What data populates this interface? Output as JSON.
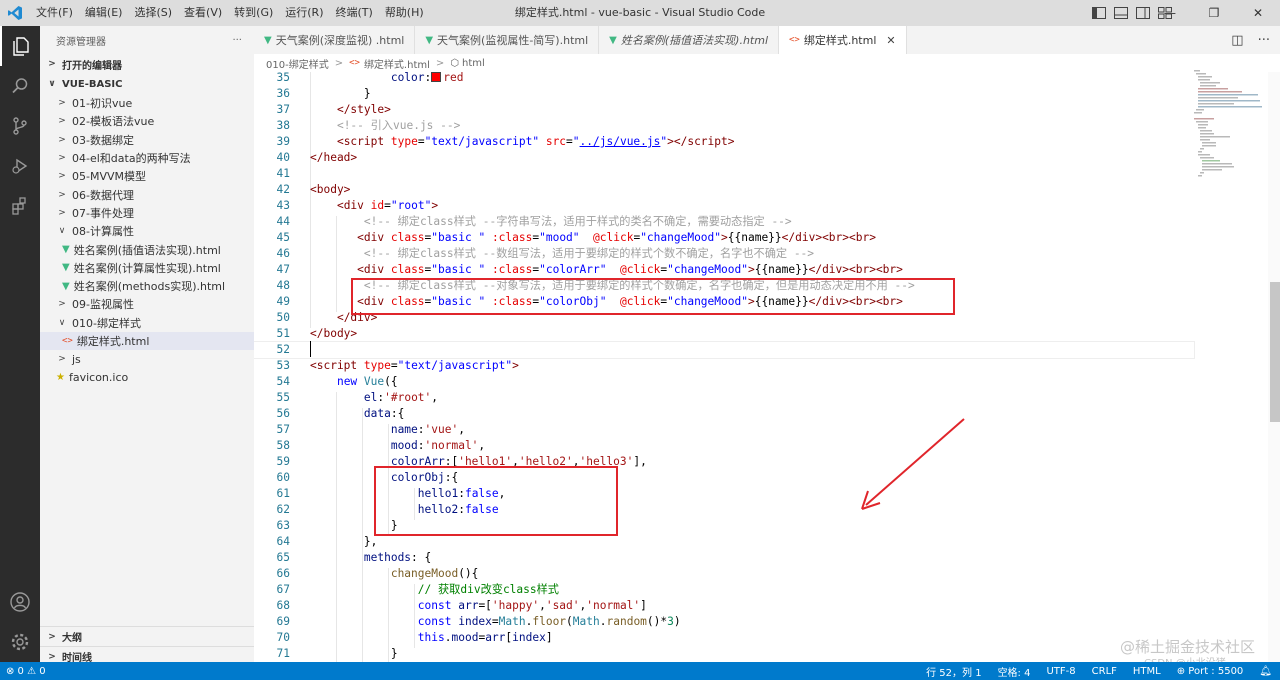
{
  "window": {
    "title": "绑定样式.html - vue-basic - Visual Studio Code",
    "menu": [
      "文件(F)",
      "编辑(E)",
      "选择(S)",
      "查看(V)",
      "转到(G)",
      "运行(R)",
      "终端(T)",
      "帮助(H)"
    ]
  },
  "sidebar": {
    "header": "资源管理器",
    "more": "···",
    "open_editors": "打开的编辑器",
    "project": "VUE-BASIC",
    "items": [
      {
        "label": "01-初识vue",
        "type": "folder",
        "indent": 1
      },
      {
        "label": "02-模板语法vue",
        "type": "folder",
        "indent": 1
      },
      {
        "label": "03-数据绑定",
        "type": "folder",
        "indent": 1
      },
      {
        "label": "04-el和data的两种写法",
        "type": "folder",
        "indent": 1
      },
      {
        "label": "05-MVVM模型",
        "type": "folder",
        "indent": 1
      },
      {
        "label": "06-数据代理",
        "type": "folder",
        "indent": 1
      },
      {
        "label": "07-事件处理",
        "type": "folder",
        "indent": 1
      },
      {
        "label": "08-计算属性",
        "type": "folder-open",
        "indent": 1
      },
      {
        "label": "姓名案例(插值语法实现).html",
        "type": "vue-file",
        "indent": 2
      },
      {
        "label": "姓名案例(计算属性实现).html",
        "type": "vue-file",
        "indent": 2
      },
      {
        "label": "姓名案例(methods实现).html",
        "type": "vue-file",
        "indent": 2
      },
      {
        "label": "09-监视属性",
        "type": "folder",
        "indent": 1
      },
      {
        "label": "010-绑定样式",
        "type": "folder-open",
        "indent": 1
      },
      {
        "label": "绑定样式.html",
        "type": "html-file",
        "indent": 2,
        "selected": true
      },
      {
        "label": "js",
        "type": "folder",
        "indent": 1
      },
      {
        "label": "favicon.ico",
        "type": "ico-file",
        "indent": 1
      }
    ],
    "outline": "大纲",
    "timeline": "时间线"
  },
  "tabs": [
    {
      "label": "天气案例(深度监视) .html",
      "icon": "vue",
      "active": false,
      "italic": false
    },
    {
      "label": "天气案例(监视属性-简写).html",
      "icon": "vue",
      "active": false,
      "italic": false
    },
    {
      "label": "姓名案例(插值语法实现).html",
      "icon": "vue",
      "active": false,
      "italic": true
    },
    {
      "label": "绑定样式.html",
      "icon": "html",
      "active": true,
      "italic": false
    }
  ],
  "breadcrumb": [
    "010-绑定样式",
    "绑定样式.html",
    "html"
  ],
  "editor": {
    "current_line": 52,
    "lines": [
      {
        "n": 35,
        "html": "            <span class=\"t-prop\">color</span>:<span class=\"swatch\"></span><span class=\"t-str2\">red</span>"
      },
      {
        "n": 36,
        "html": "        }"
      },
      {
        "n": 37,
        "html": "    <span class=\"t-tag\">&lt;/style&gt;</span>"
      },
      {
        "n": 38,
        "html": "    <span class=\"t-com2\">&lt;!-- 引入vue.js --&gt;</span>"
      },
      {
        "n": 39,
        "html": "    <span class=\"t-tag\">&lt;script</span> <span class=\"t-attr\">type</span>=<span class=\"t-str\">\"text/javascript\"</span> <span class=\"t-attr\">src</span>=<span class=\"t-str\">\"<u>../js/vue.js</u>\"</span><span class=\"t-tag\">&gt;&lt;/script&gt;</span>"
      },
      {
        "n": 40,
        "html": "<span class=\"t-tag\">&lt;/head&gt;</span>"
      },
      {
        "n": 41,
        "html": ""
      },
      {
        "n": 42,
        "html": "<span class=\"t-tag\">&lt;body&gt;</span>"
      },
      {
        "n": 43,
        "html": "    <span class=\"t-tag\">&lt;div</span> <span class=\"t-attr\">id</span>=<span class=\"t-str\">\"root\"</span><span class=\"t-tag\">&gt;</span>"
      },
      {
        "n": 44,
        "html": "        <span class=\"t-com2\">&lt;!-- 绑定class样式 --字符串写法，适用于样式的类名不确定，需要动态指定 --&gt;</span>"
      },
      {
        "n": 45,
        "html": "       <span class=\"t-tag\">&lt;div</span> <span class=\"t-attr\">class</span>=<span class=\"t-str\">\"basic \"</span> <span class=\"t-attr\">:class</span>=<span class=\"t-str\">\"mood\"</span>  <span class=\"t-attr\">@click</span>=<span class=\"t-str\">\"changeMood\"</span><span class=\"t-tag\">&gt;</span>{{name}}<span class=\"t-tag\">&lt;/div&gt;&lt;br&gt;&lt;br&gt;</span>"
      },
      {
        "n": 46,
        "html": "        <span class=\"t-com2\">&lt;!-- 绑定class样式 --数组写法，适用于要绑定的样式个数不确定，名字也不确定 --&gt;</span>"
      },
      {
        "n": 47,
        "html": "       <span class=\"t-tag\">&lt;div</span> <span class=\"t-attr\">class</span>=<span class=\"t-str\">\"basic \"</span> <span class=\"t-attr\">:class</span>=<span class=\"t-str\">\"colorArr\"</span>  <span class=\"t-attr\">@click</span>=<span class=\"t-str\">\"changeMood\"</span><span class=\"t-tag\">&gt;</span>{{name}}<span class=\"t-tag\">&lt;/div&gt;&lt;br&gt;&lt;br&gt;</span>"
      },
      {
        "n": 48,
        "html": "        <span class=\"t-com2\">&lt;!-- 绑定class样式 --对象写法，适用于要绑定的样式个数确定，名字也确定，但是用动态决定用不用 --&gt;</span>"
      },
      {
        "n": 49,
        "html": "       <span class=\"t-tag\">&lt;div</span> <span class=\"t-attr\">class</span>=<span class=\"t-str\">\"basic \"</span> <span class=\"t-attr\">:class</span>=<span class=\"t-str\">\"colorObj\"</span>  <span class=\"t-attr\">@click</span>=<span class=\"t-str\">\"changeMood\"</span><span class=\"t-tag\">&gt;</span>{{name}}<span class=\"t-tag\">&lt;/div&gt;&lt;br&gt;&lt;br&gt;</span>"
      },
      {
        "n": 50,
        "html": "    <span class=\"t-tag\">&lt;/div&gt;</span>"
      },
      {
        "n": 51,
        "html": "<span class=\"t-tag\">&lt;/body&gt;</span>"
      },
      {
        "n": 52,
        "html": ""
      },
      {
        "n": 53,
        "html": "<span class=\"t-tag\">&lt;script</span> <span class=\"t-attr\">type</span>=<span class=\"t-str\">\"text/javascript\"</span><span class=\"t-tag\">&gt;</span>"
      },
      {
        "n": 54,
        "html": "    <span class=\"t-kw\">new</span> <span class=\"t-cls\">Vue</span>({"
      },
      {
        "n": 55,
        "html": "        <span class=\"t-prop\">el</span>:<span class=\"t-str2\">'#root'</span>,"
      },
      {
        "n": 56,
        "html": "        <span class=\"t-prop\">data</span>:{"
      },
      {
        "n": 57,
        "html": "            <span class=\"t-prop\">name</span>:<span class=\"t-str2\">'vue'</span>,"
      },
      {
        "n": 58,
        "html": "            <span class=\"t-prop\">mood</span>:<span class=\"t-str2\">'normal'</span>,"
      },
      {
        "n": 59,
        "html": "            <span class=\"t-prop\">colorArr</span>:[<span class=\"t-str2\">'hello1'</span>,<span class=\"t-str2\">'hello2'</span>,<span class=\"t-str2\">'hello3'</span>],"
      },
      {
        "n": 60,
        "html": "            <span class=\"t-prop\">colorObj</span>:{"
      },
      {
        "n": 61,
        "html": "                <span class=\"t-prop\">hello1</span>:<span class=\"t-kw\">false</span>,"
      },
      {
        "n": 62,
        "html": "                <span class=\"t-prop\">hello2</span>:<span class=\"t-kw\">false</span>"
      },
      {
        "n": 63,
        "html": "            }"
      },
      {
        "n": 64,
        "html": "        },"
      },
      {
        "n": 65,
        "html": "        <span class=\"t-prop\">methods</span>: {"
      },
      {
        "n": 66,
        "html": "            <span class=\"t-fn\">changeMood</span>(){"
      },
      {
        "n": 67,
        "html": "                <span class=\"t-com\">// 获取div改变class样式</span>"
      },
      {
        "n": 68,
        "html": "                <span class=\"t-kw\">const</span> <span class=\"t-prop\">arr</span>=[<span class=\"t-str2\">'happy'</span>,<span class=\"t-str2\">'sad'</span>,<span class=\"t-str2\">'normal'</span>]"
      },
      {
        "n": 69,
        "html": "                <span class=\"t-kw\">const</span> <span class=\"t-prop\">index</span>=<span class=\"t-cls\">Math</span>.<span class=\"t-fn\">floor</span>(<span class=\"t-cls\">Math</span>.<span class=\"t-fn\">random</span>()*<span class=\"t-num\">3</span>)"
      },
      {
        "n": 70,
        "html": "                <span class=\"t-kw\">this</span>.<span class=\"t-prop\">mood</span>=<span class=\"t-prop\">arr</span>[<span class=\"t-prop\">index</span>]"
      },
      {
        "n": 71,
        "html": "            }"
      },
      {
        "n": 72,
        "html": "        }"
      }
    ]
  },
  "watermark": {
    "main": "@稀土掘金技术社区",
    "sub": "CSDN @小北没猪"
  },
  "statusbar": {
    "problems": "⊗ 0 ⚠ 0",
    "position": "行 52，列 1",
    "spaces": "空格: 4",
    "encoding": "UTF-8",
    "eol": "CRLF",
    "language": "HTML",
    "port": "⊕ Port : 5500"
  },
  "colors": {
    "accent": "#007acc",
    "annotation": "#e0252b",
    "activity_bar": "#2c2c2c",
    "sidebar": "#f3f3f3"
  }
}
